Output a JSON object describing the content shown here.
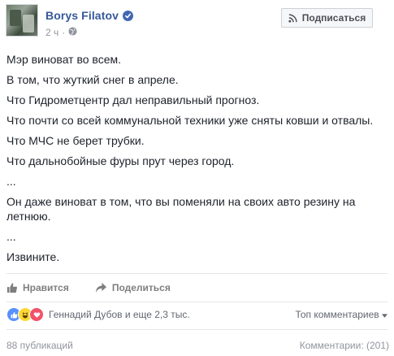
{
  "post": {
    "author": "Borys Filatov",
    "time": "2 ч",
    "meta_separator": "·",
    "subscribe_label": "Подписаться",
    "lines": [
      "Мэр виноват во всем.",
      "В том, что жуткий снег в апреле.",
      "Что Гидрометцентр дал неправильный прогноз.",
      "Что почти со всей коммунальной техники уже сняты ковши и отвалы.",
      "Что МЧС не берет трубки.",
      "Что дальнобойные фуры прут через город.",
      "...",
      "Он даже виноват в том, что вы поменяли на своих авто резину на летнюю.",
      "...",
      "Извините."
    ]
  },
  "actions": {
    "like_label": "Нравится",
    "share_label": "Поделиться"
  },
  "reactions": {
    "text": "Геннадий Дубов и еще 2,3 тыс.",
    "top_comments_label": "Топ комментариев"
  },
  "footer": {
    "publications": "88 публикаций",
    "comments": "Комментарии: (201)"
  },
  "colors": {
    "link": "#365899",
    "muted": "#90949c",
    "text": "#1d2129"
  }
}
